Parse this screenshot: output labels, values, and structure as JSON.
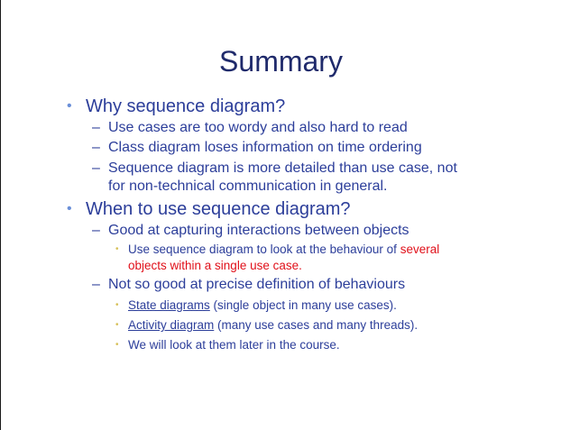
{
  "title": "Summary",
  "items": {
    "q1": "Why sequence diagram?",
    "q1_sub1": "Use cases are too wordy and also hard to read",
    "q1_sub2": "Class diagram loses information on time ordering",
    "q1_sub3_line1": "Sequence diagram is more detailed than use case, not",
    "q1_sub3_line2": "for non-technical communication in general.",
    "q2": "When to use sequence diagram?",
    "q2_sub1": "Good at capturing interactions between objects",
    "q2_sub1_detail_a": "Use sequence diagram to look at the behaviour of ",
    "q2_sub1_detail_b": "several",
    "q2_sub1_detail_line2": "objects within a single use case.",
    "q2_sub2": "Not so good at precise definition of behaviours",
    "q2_sub2_d1_link": "State diagrams",
    "q2_sub2_d1_rest": " (single object in many use cases).",
    "q2_sub2_d2_link": "Activity diagram",
    "q2_sub2_d2_rest": " (many use cases and many threads).",
    "q2_sub2_d3": "We will look at them later in the course."
  },
  "glyphs": {
    "bullet": "•",
    "dash": "–",
    "dot": "•"
  },
  "colors": {
    "title": "#1f2a6b",
    "text": "#2c3e9a",
    "emphasis": "#e0101a",
    "bullet": "#6a8fd8",
    "dot": "#d7c15a"
  }
}
